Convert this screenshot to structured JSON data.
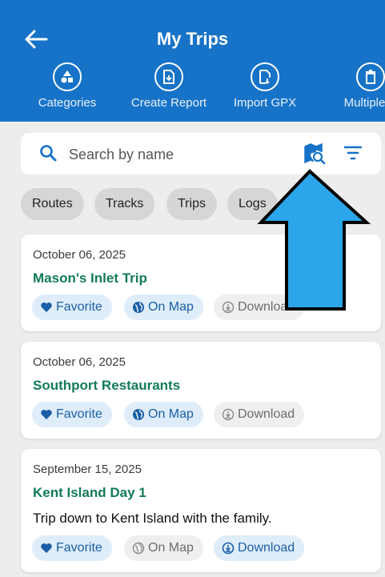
{
  "header": {
    "title": "My Trips",
    "actions": [
      {
        "label": "Categories",
        "icon": "categories-icon"
      },
      {
        "label": "Create Report",
        "icon": "report-icon"
      },
      {
        "label": "Import GPX",
        "icon": "import-icon"
      },
      {
        "label": "Multiple D",
        "icon": "trash-icon"
      }
    ]
  },
  "search": {
    "placeholder": "Search by name"
  },
  "filters": [
    "Routes",
    "Tracks",
    "Trips",
    "Logs"
  ],
  "trips": [
    {
      "date": "October 06, 2025",
      "name": "Mason's Inlet Trip",
      "description": "",
      "favorite": "Favorite",
      "on_map": "On Map",
      "download": "Download"
    },
    {
      "date": "October 06, 2025",
      "name": "Southport Restaurants",
      "description": "",
      "favorite": "Favorite",
      "on_map": "On Map",
      "download": "Download"
    },
    {
      "date": "September 15, 2025",
      "name": "Kent Island Day 1",
      "description": "Trip down to Kent Island with the family.",
      "favorite": "Favorite",
      "on_map": "On Map",
      "download": "Download"
    }
  ],
  "colors": {
    "header": "#1773c7",
    "accent_green": "#137a5a",
    "pill_active_bg": "#deedf9",
    "pill_active_text": "#1b5fa6",
    "arrow_fill": "#2ba6ea"
  }
}
